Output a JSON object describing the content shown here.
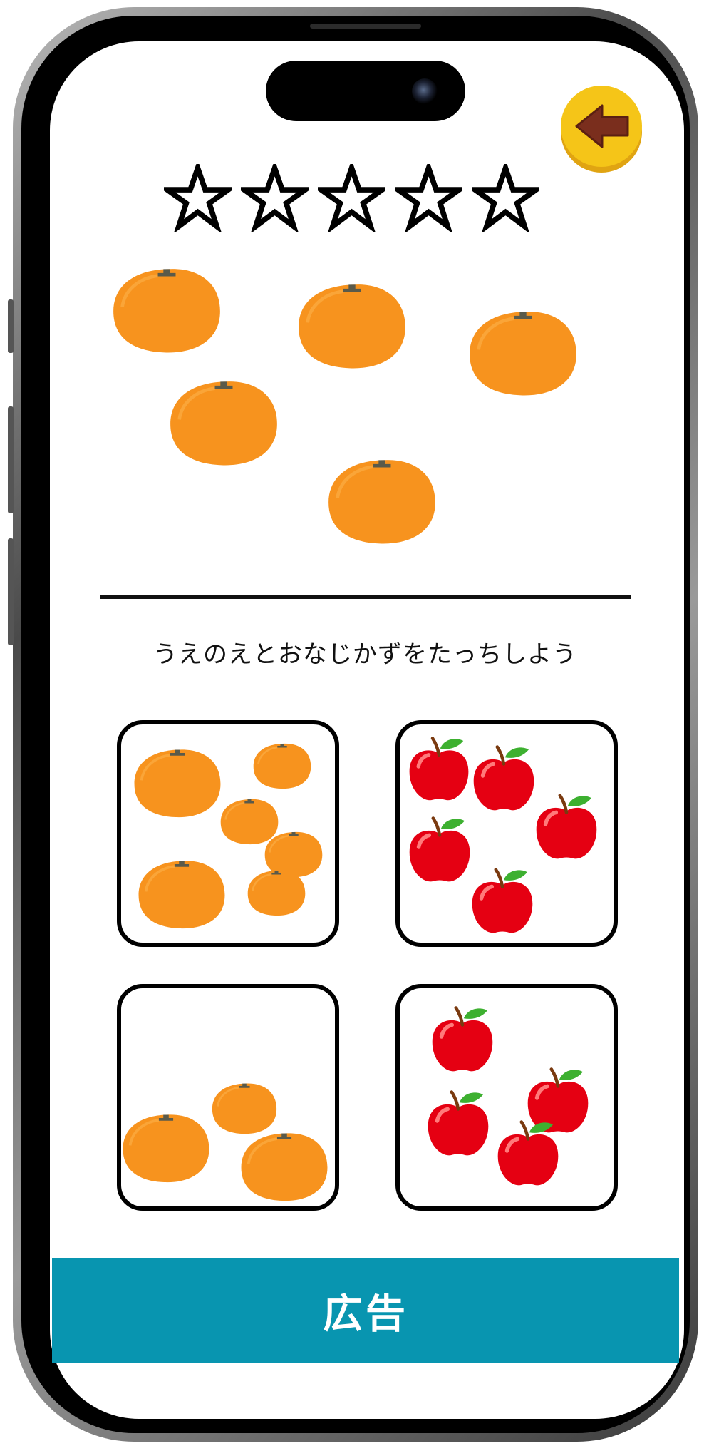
{
  "stars": {
    "count": 5,
    "filled": 0
  },
  "question": {
    "fruit": "orange",
    "count": 5
  },
  "instruction": "うえのえとおなじかずをたっちしよう",
  "choices": [
    {
      "fruit": "orange",
      "count": 6
    },
    {
      "fruit": "apple",
      "count": 5
    },
    {
      "fruit": "orange",
      "count": 3
    },
    {
      "fruit": "apple",
      "count": 4
    }
  ],
  "ad": {
    "label": "広告"
  },
  "icons": {
    "back": "back-arrow-icon",
    "star": "star-outline-icon"
  },
  "colors": {
    "orange": "#f7931e",
    "apple": "#e50012",
    "back_button": "#f5c518",
    "ad_banner": "#0895b0"
  }
}
